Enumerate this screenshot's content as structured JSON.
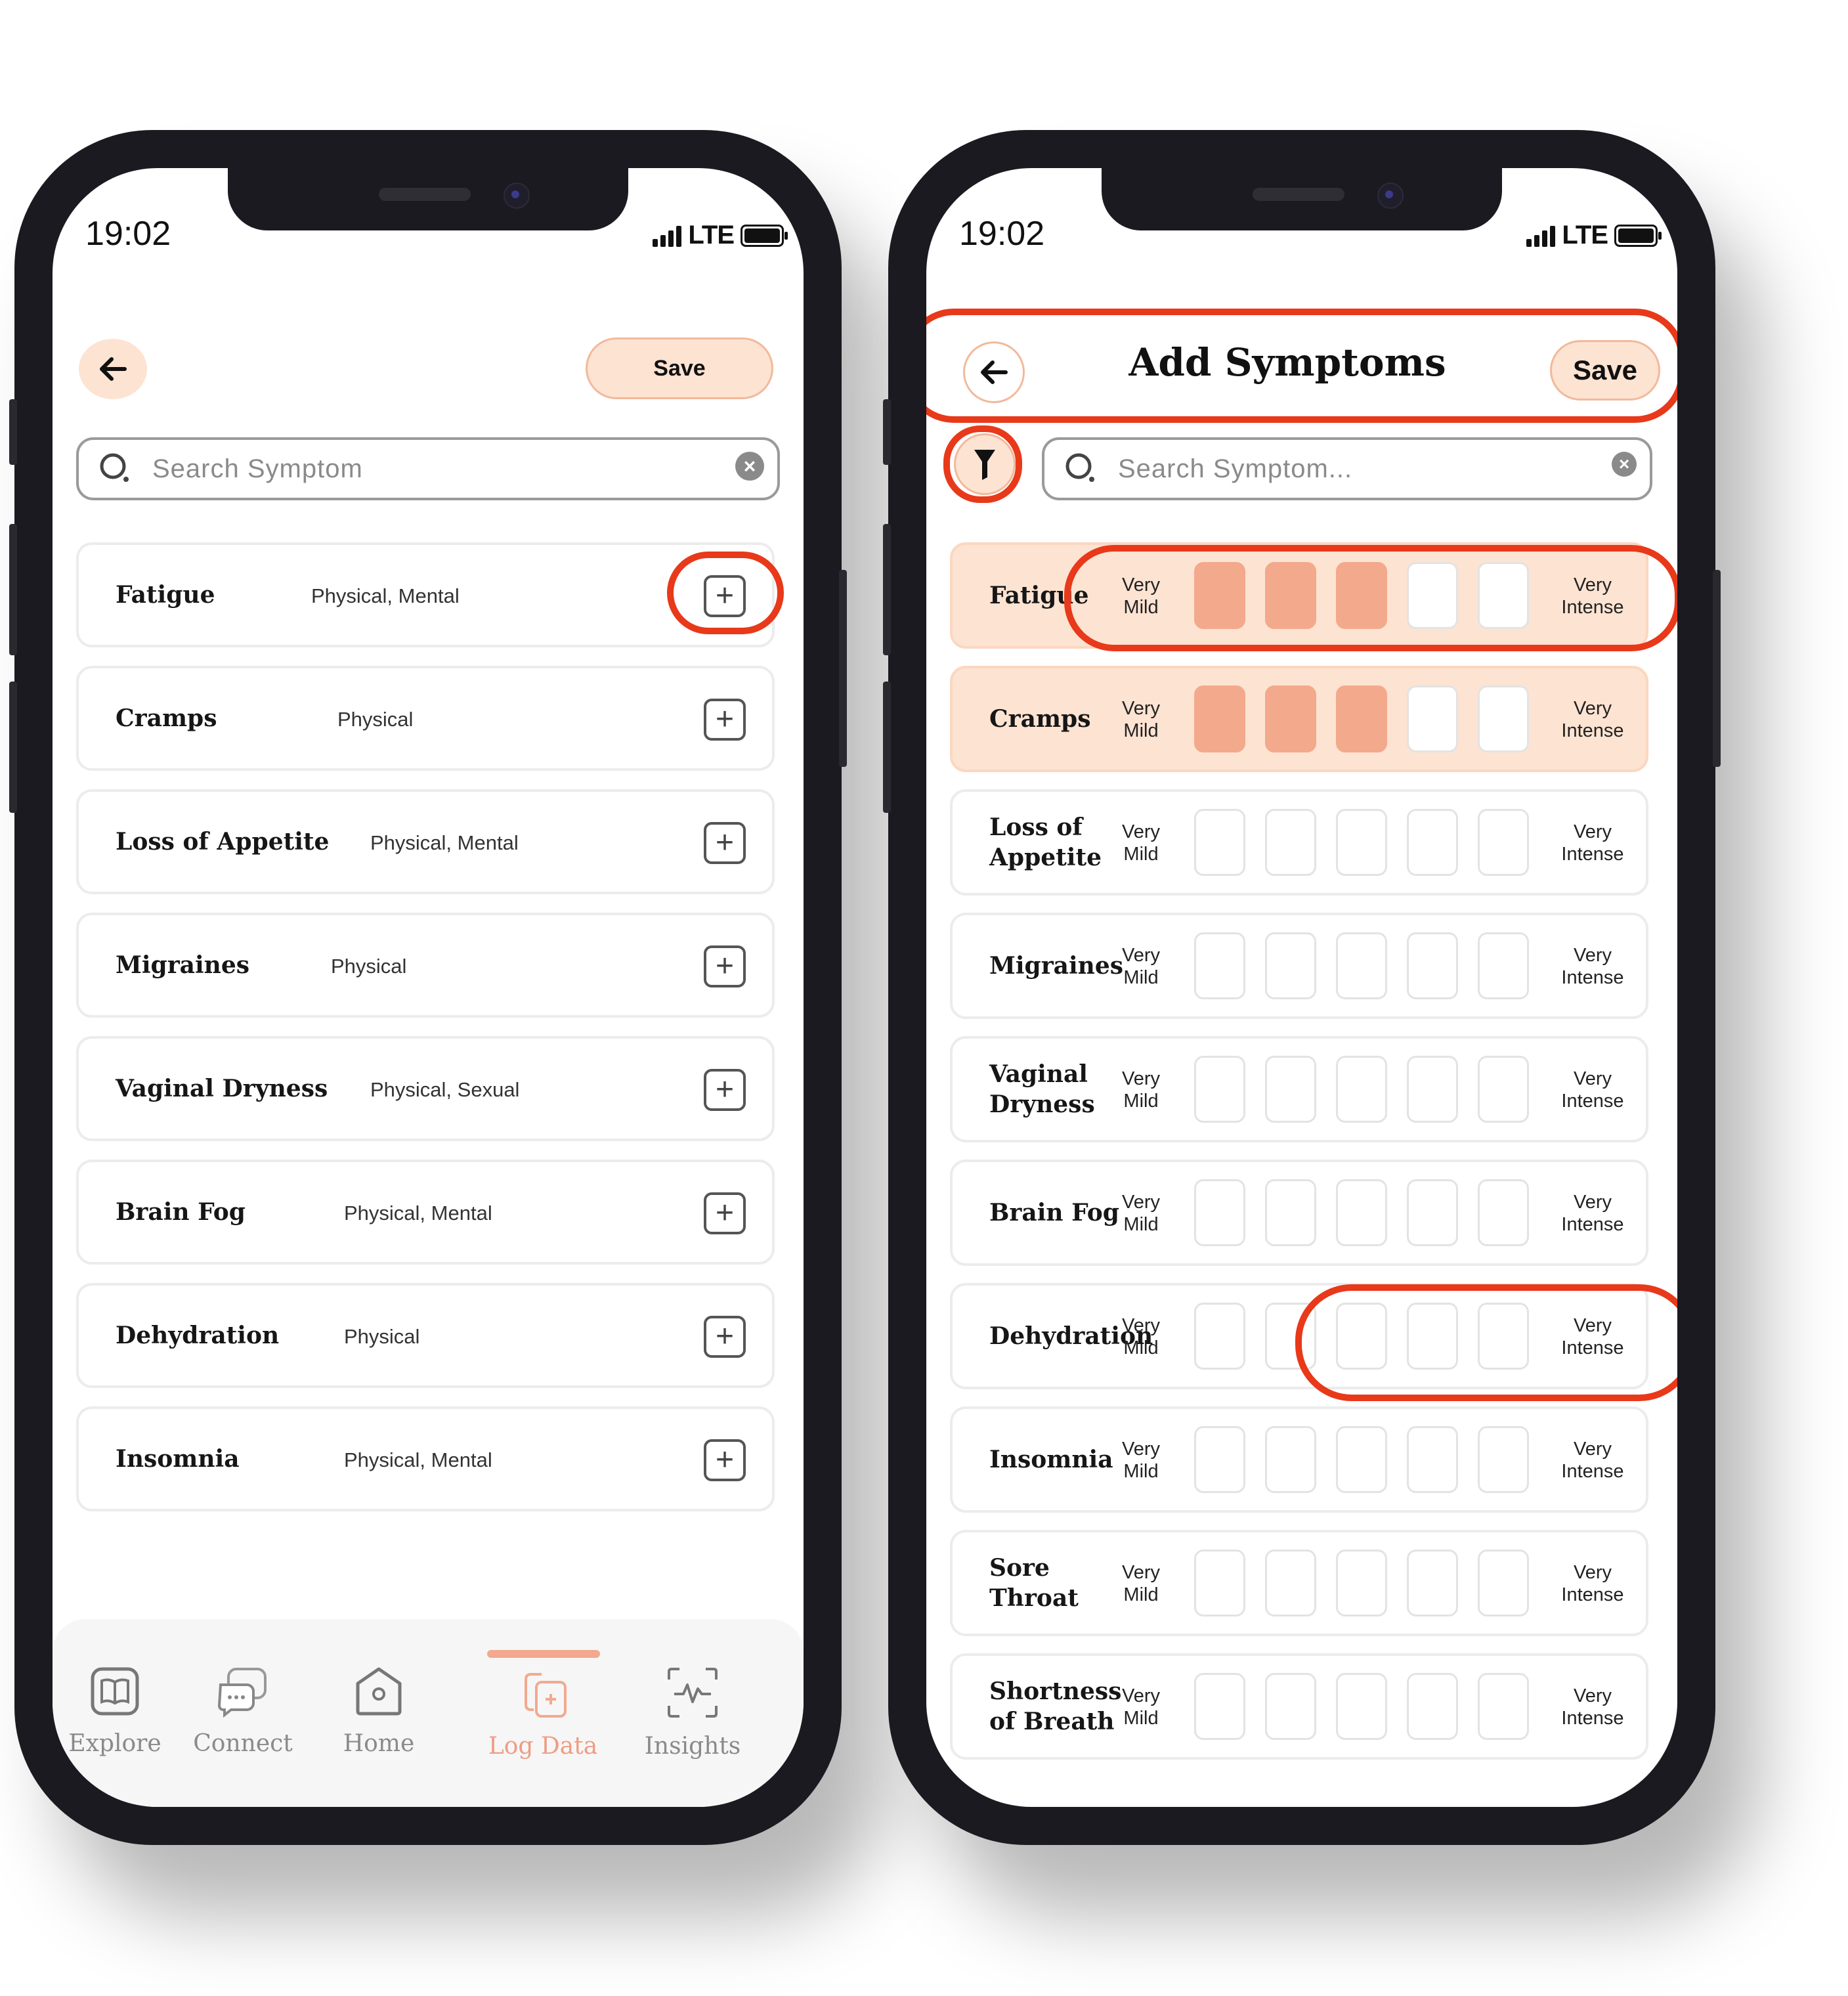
{
  "status_bar": {
    "time": "19:02",
    "network": "LTE"
  },
  "left_screen": {
    "save_label": "Save",
    "search_placeholder": "Search Symptom",
    "symptoms": [
      {
        "name": "Fatigue",
        "categories": "Physical, Mental"
      },
      {
        "name": "Cramps",
        "categories": "Physical"
      },
      {
        "name": "Loss of Appetite",
        "categories": "Physical, Mental"
      },
      {
        "name": "Migraines",
        "categories": "Physical"
      },
      {
        "name": "Vaginal Dryness",
        "categories": "Physical, Sexual"
      },
      {
        "name": "Brain Fog",
        "categories": "Physical, Mental"
      },
      {
        "name": "Dehydration",
        "categories": "Physical"
      },
      {
        "name": "Insomnia",
        "categories": "Physical, Mental"
      }
    ],
    "nav": [
      {
        "label": "Explore",
        "icon": "book-icon"
      },
      {
        "label": "Connect",
        "icon": "chat-icon"
      },
      {
        "label": "Home",
        "icon": "home-icon"
      },
      {
        "label": "Log Data",
        "icon": "log-data-icon",
        "active": true
      },
      {
        "label": "Insights",
        "icon": "insights-icon"
      }
    ]
  },
  "right_screen": {
    "title": "Add Symptoms",
    "save_label": "Save",
    "search_placeholder": "Search Symptom...",
    "scale_min_label": "Very Mild",
    "scale_max_label": "Very Intense",
    "scale_colors": {
      "filled": "#f3a98c",
      "active_card": "#fde3d2",
      "highlight_ring": "#e8391a"
    },
    "symptoms": [
      {
        "name": "Fatigue",
        "level": 3
      },
      {
        "name": "Cramps",
        "level": 3
      },
      {
        "name": "Loss of Appetite",
        "level": 0
      },
      {
        "name": "Migraines",
        "level": 0
      },
      {
        "name": "Vaginal Dryness",
        "level": 0
      },
      {
        "name": "Brain Fog",
        "level": 0
      },
      {
        "name": "Dehydration",
        "level": 0
      },
      {
        "name": "Insomnia",
        "level": 0
      },
      {
        "name": "Sore Throat",
        "level": 0
      },
      {
        "name": "Shortness of Breath",
        "level": 0
      }
    ],
    "scale_max": 5
  }
}
